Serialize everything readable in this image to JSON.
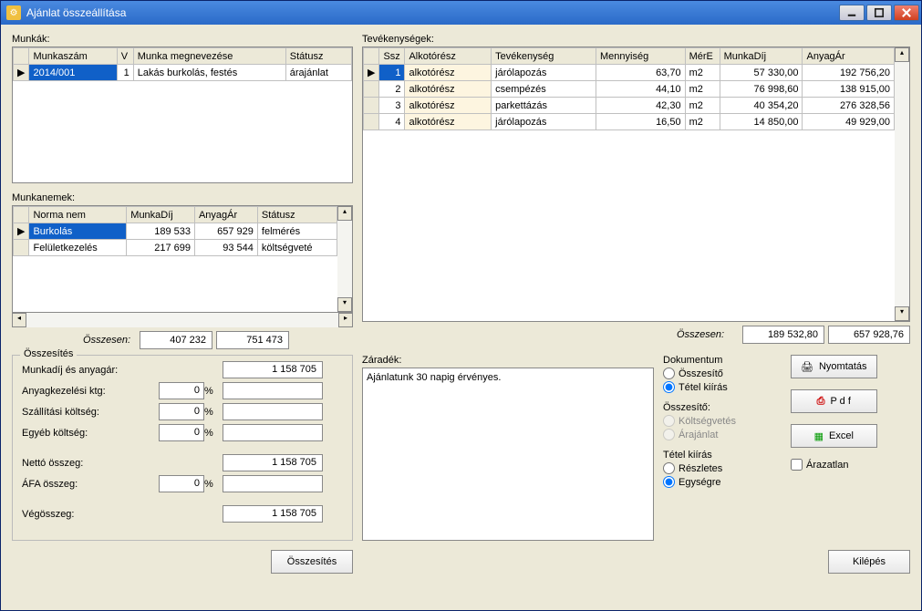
{
  "window": {
    "title": "Ajánlat összeállítása"
  },
  "labels": {
    "munkak": "Munkák:",
    "munkanemek": "Munkanemek:",
    "tevekenysegek": "Tevékenységek:",
    "osszesen_left": "Összesen:",
    "osszesen_right": "Összesen:",
    "zaradek": "Záradék:"
  },
  "munkak": {
    "headers": {
      "szam": "Munkaszám",
      "v": "V",
      "megn": "Munka megnevezése",
      "statusz": "Státusz"
    },
    "rows": [
      {
        "szam": "2014/001",
        "v": "1",
        "megn": "Lakás burkolás, festés",
        "statusz": "árajánlat"
      }
    ]
  },
  "munkanemek": {
    "headers": {
      "norma": "Norma nem",
      "dij": "MunkaDíj",
      "ar": "AnyagÁr",
      "statusz": "Státusz"
    },
    "rows": [
      {
        "norma": "Burkolás",
        "dij": "189 533",
        "ar": "657 929",
        "statusz": "felmérés"
      },
      {
        "norma": "Felületkezelés",
        "dij": "217 699",
        "ar": "93 544",
        "statusz": "költségveté"
      }
    ],
    "total_dij": "407 232",
    "total_ar": "751 473"
  },
  "tevekenysegek": {
    "headers": {
      "ssz": "Ssz",
      "alkot": "Alkotórész",
      "tev": "Tevékenység",
      "menny": "Mennyiség",
      "mere": "MérE",
      "dij": "MunkaDíj",
      "ar": "AnyagÁr"
    },
    "rows": [
      {
        "ssz": "1",
        "alkot": "alkotórész",
        "tev": "járólapozás",
        "menny": "63,70",
        "mere": "m2",
        "dij": "57 330,00",
        "ar": "192 756,20"
      },
      {
        "ssz": "2",
        "alkot": "alkotórész",
        "tev": "csempézés",
        "menny": "44,10",
        "mere": "m2",
        "dij": "76 998,60",
        "ar": "138 915,00"
      },
      {
        "ssz": "3",
        "alkot": "alkotórész",
        "tev": "parkettázás",
        "menny": "42,30",
        "mere": "m2",
        "dij": "40 354,20",
        "ar": "276 328,56"
      },
      {
        "ssz": "4",
        "alkot": "alkotórész",
        "tev": "járólapozás",
        "menny": "16,50",
        "mere": "m2",
        "dij": "14 850,00",
        "ar": "49 929,00"
      }
    ],
    "total_dij": "189 532,80",
    "total_ar": "657 928,76"
  },
  "osszesites": {
    "legend": "Összesítés",
    "rows": {
      "munkadij_label": "Munkadíj és anyagár:",
      "munkadij_val": "1 158 705",
      "anyagkez_label": "Anyagkezelési ktg:",
      "anyagkez_pct": "0",
      "anyagkez_val": "",
      "szall_label": "Szállítási költség:",
      "szall_pct": "0",
      "szall_val": "",
      "egyeb_label": "Egyéb költség:",
      "egyeb_pct": "0",
      "egyeb_val": "",
      "netto_label": "Nettó összeg:",
      "netto_val": "1 158 705",
      "afa_label": "ÁFA összeg:",
      "afa_pct": "0",
      "afa_val": "",
      "veg_label": "Végösszeg:",
      "veg_val": "1 158 705"
    },
    "button": "Összesítés"
  },
  "zaradek_text": "Ajánlatunk 30 napig érvényes.",
  "options": {
    "dokumentum": "Dokumentum",
    "osszesito_opt": "Összesítő",
    "tetel_opt": "Tétel kiírás",
    "osszesito_group": "Összesítő:",
    "koltsegvetes": "Költségvetés",
    "arajanlat": "Árajánlat",
    "tetel_group": "Tétel kiírás",
    "reszletes": "Részletes",
    "egysegre": "Egységre",
    "arazatlan": "Árazatlan"
  },
  "buttons": {
    "nyomtatas": "Nyomtatás",
    "pdf": "P d f",
    "excel": "Excel",
    "kilepes": "Kilépés"
  }
}
